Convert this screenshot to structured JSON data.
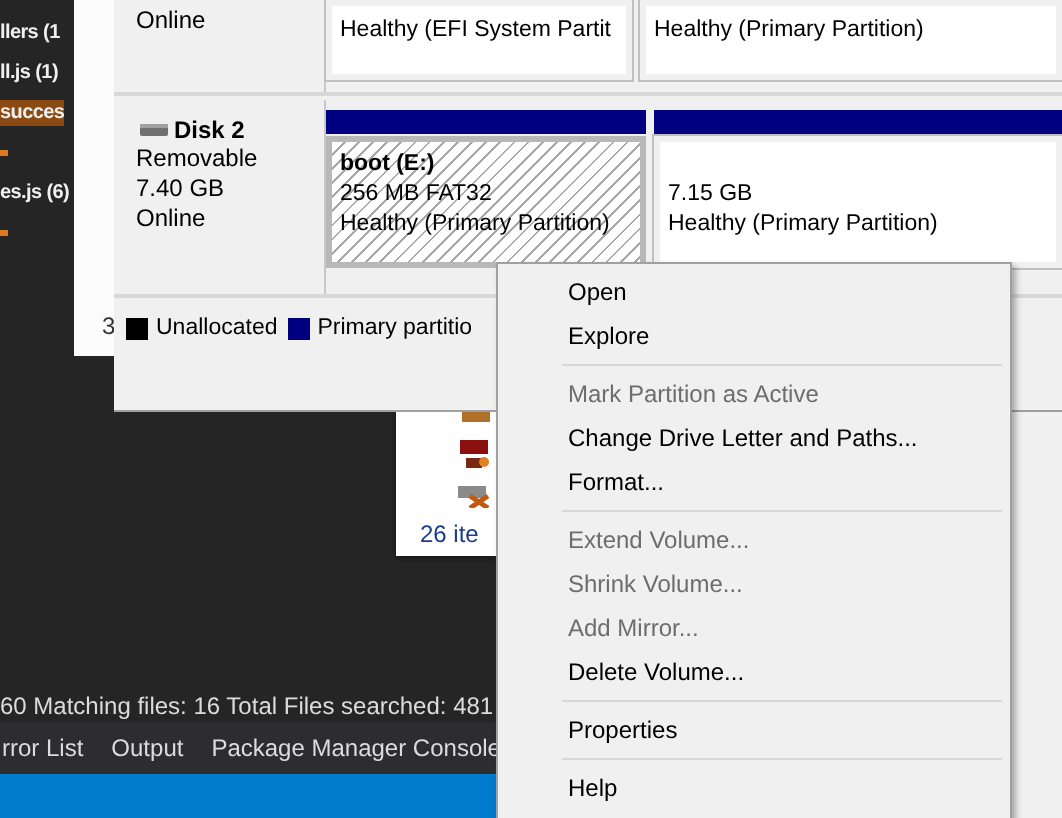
{
  "ide": {
    "solution_items": [
      {
        "kind": "entry",
        "label": "llers (1",
        "selected": false
      },
      {
        "kind": "entry",
        "label": "ll.js (1)",
        "selected": false
      },
      {
        "kind": "entry",
        "label": "succes",
        "selected": true
      },
      {
        "kind": "marker"
      },
      {
        "kind": "entry",
        "label": "es.js (6)",
        "selected": false
      },
      {
        "kind": "marker"
      }
    ],
    "find_results": "60 Matching files: 16 Total Files searched: 481",
    "tabs": [
      {
        "label": "rror List"
      },
      {
        "label": "Output"
      },
      {
        "label": "Package Manager Console"
      }
    ]
  },
  "back_window": {
    "fragment": "3"
  },
  "disk_management": {
    "disks": [
      {
        "status": "Online",
        "partitions": [
          {
            "lines": [
              "Healthy (EFI System Partit"
            ],
            "selected": false
          },
          {
            "lines": [
              "Healthy (Primary Partition)"
            ],
            "selected": false
          }
        ]
      },
      {
        "name": "Disk 2",
        "type": "Removable",
        "size": "7.40 GB",
        "status": "Online",
        "partitions": [
          {
            "lines": [
              "boot  (E:)",
              "256 MB FAT32",
              "Healthy (Primary Partition)"
            ],
            "selected": true
          },
          {
            "lines": [
              "7.15 GB",
              "Healthy (Primary Partition)"
            ],
            "selected": false
          }
        ]
      }
    ],
    "legend": [
      {
        "label": "Unallocated",
        "color": "#000000"
      },
      {
        "label": "Primary partitio",
        "color": "#000080"
      }
    ]
  },
  "explorer": {
    "status": "26 ite"
  },
  "context_menu": {
    "items": [
      {
        "kind": "item",
        "label": "Open",
        "disabled": false
      },
      {
        "kind": "item",
        "label": "Explore",
        "disabled": false
      },
      {
        "kind": "separator"
      },
      {
        "kind": "item",
        "label": "Mark Partition as Active",
        "disabled": true
      },
      {
        "kind": "item",
        "label": "Change Drive Letter and Paths...",
        "disabled": false
      },
      {
        "kind": "item",
        "label": "Format...",
        "disabled": false
      },
      {
        "kind": "separator"
      },
      {
        "kind": "item",
        "label": "Extend Volume...",
        "disabled": true
      },
      {
        "kind": "item",
        "label": "Shrink Volume...",
        "disabled": true
      },
      {
        "kind": "item",
        "label": "Add Mirror...",
        "disabled": true
      },
      {
        "kind": "item",
        "label": "Delete Volume...",
        "disabled": false
      },
      {
        "kind": "separator"
      },
      {
        "kind": "item",
        "label": "Properties",
        "disabled": false
      },
      {
        "kind": "separator"
      },
      {
        "kind": "item",
        "label": "Help",
        "disabled": false
      }
    ]
  }
}
